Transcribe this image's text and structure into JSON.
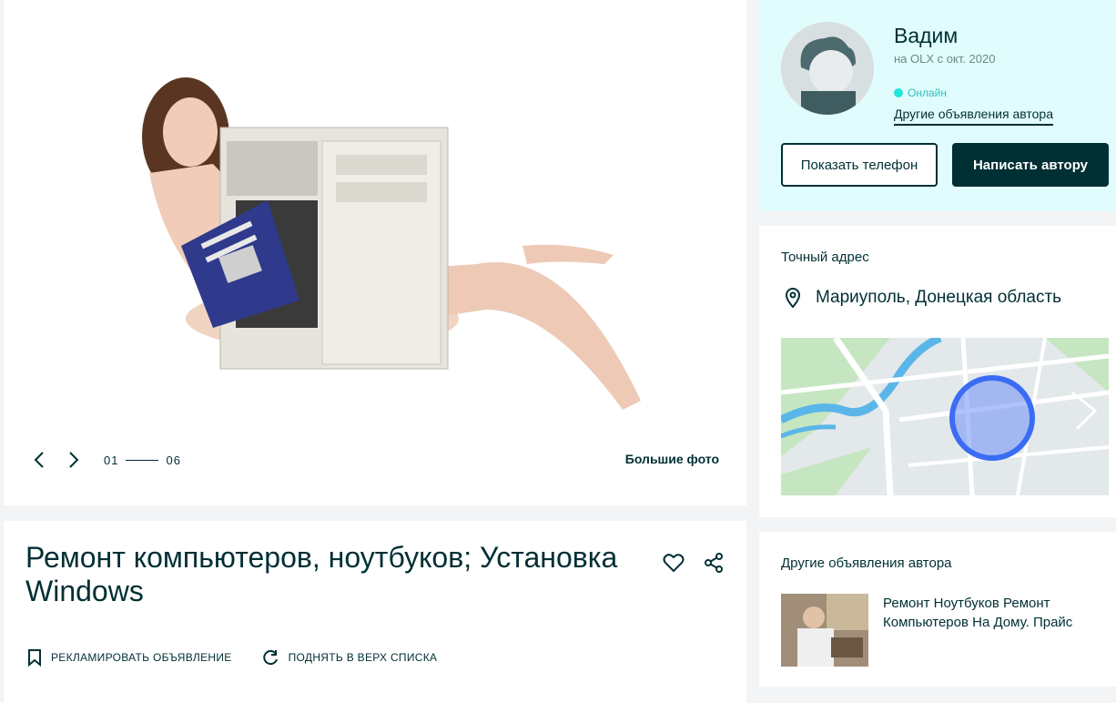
{
  "gallery": {
    "counter_current": "01",
    "counter_total": "06",
    "big_photos_label": "Большие фото"
  },
  "ad": {
    "title": "Ремонт компьютеров, ноутбуков; Установка Windows",
    "promote_label": "РЕКЛАМИРОВАТЬ ОБЪЯВЛЕНИЕ",
    "bump_label": "ПОДНЯТЬ В ВЕРХ СПИСКА"
  },
  "seller": {
    "name": "Вадим",
    "since": "на OLX с окт. 2020",
    "status": "Онлайн",
    "other_ads_link": "Другие объявления автора",
    "show_phone_label": "Показать телефон",
    "write_label": "Написать автору"
  },
  "address": {
    "heading": "Точный адрес",
    "location": "Мариуполь, Донецкая область"
  },
  "other_ads": {
    "heading": "Другие объявления автора",
    "items": [
      {
        "title": "Ремонт Ноутбуков Ремонт Компьютеров На Дому. Прайс"
      }
    ]
  },
  "colors": {
    "primary": "#002f34",
    "seller_bg": "#e1fcfd",
    "online": "#23e5db",
    "map_circle": "#3a6cf4"
  }
}
